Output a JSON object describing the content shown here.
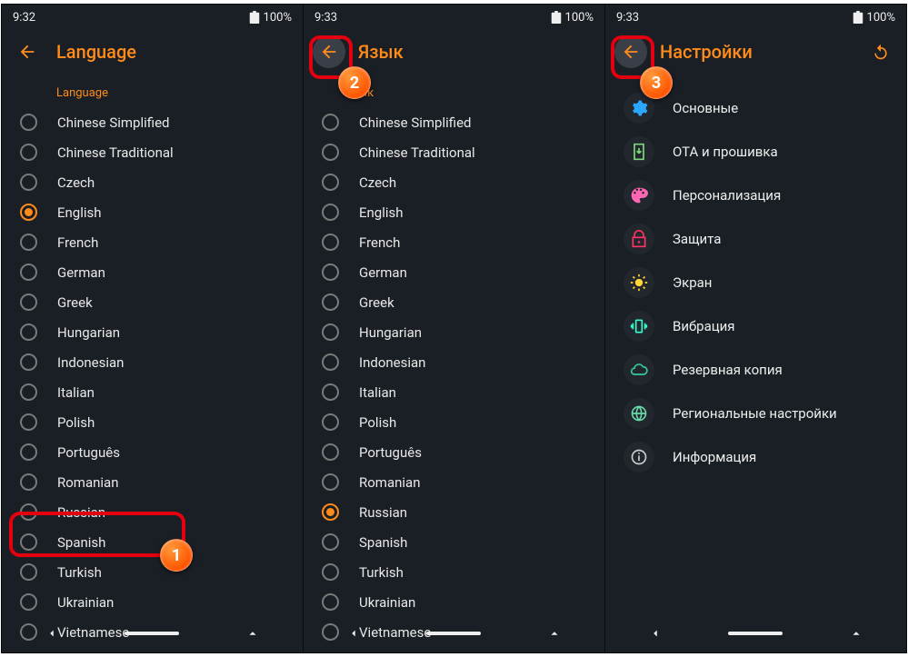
{
  "screen1": {
    "time": "9:32",
    "battery": "100%",
    "title": "Language",
    "section": "Language",
    "selected": "English",
    "step": "1"
  },
  "screen2": {
    "time": "9:33",
    "battery": "100%",
    "title": "Язык",
    "section": "ык",
    "selected": "Russian",
    "step": "2"
  },
  "screen3": {
    "time": "9:33",
    "battery": "100%",
    "title": "Настройки",
    "step": "3"
  },
  "languages": [
    "Chinese Simplified",
    "Chinese Traditional",
    "Czech",
    "English",
    "French",
    "German",
    "Greek",
    "Hungarian",
    "Indonesian",
    "Italian",
    "Polish",
    "Português",
    "Romanian",
    "Russian",
    "Spanish",
    "Turkish",
    "Ukrainian",
    "Vietnamese"
  ],
  "settings": [
    {
      "label": "Основные",
      "icon": "gear",
      "color": "#2aa8ff"
    },
    {
      "label": "OTA и прошивка",
      "icon": "download",
      "color": "#7dd87d"
    },
    {
      "label": "Персонализация",
      "icon": "palette",
      "color": "#ff66b3"
    },
    {
      "label": "Защита",
      "icon": "lock",
      "color": "#ff3366"
    },
    {
      "label": "Экран",
      "icon": "sun",
      "color": "#ffd633"
    },
    {
      "label": "Вибрация",
      "icon": "vibration",
      "color": "#33ffcc"
    },
    {
      "label": "Резервная копия",
      "icon": "cloud",
      "color": "#33cc99"
    },
    {
      "label": "Региональные настройки",
      "icon": "globe",
      "color": "#66d9a6"
    },
    {
      "label": "Информация",
      "icon": "info",
      "color": "#cccccc"
    }
  ]
}
